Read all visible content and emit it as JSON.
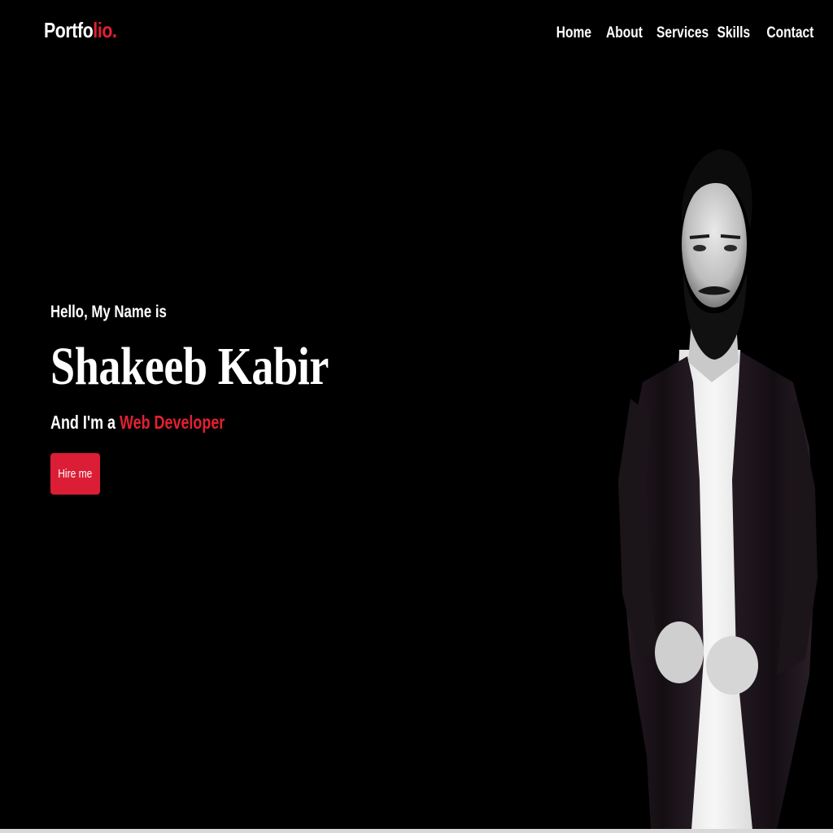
{
  "brand": {
    "logo_part1": "Portfo",
    "logo_part2": "lio.",
    "accent_color": "#e3202f",
    "button_color": "#dc1d36",
    "background_color": "#000000"
  },
  "nav": {
    "items": [
      {
        "label": "Home"
      },
      {
        "label": "About"
      },
      {
        "label": "Services"
      },
      {
        "label": "Skills"
      },
      {
        "label": "Contact"
      }
    ]
  },
  "hero": {
    "greeting": "Hello, My Name is",
    "name": "Shakeeb Kabir",
    "role_prefix": "And I'm a",
    "role": "Web Developer",
    "cta_label": "Hire me"
  },
  "portrait": {
    "icon": "person-portrait-photo"
  }
}
